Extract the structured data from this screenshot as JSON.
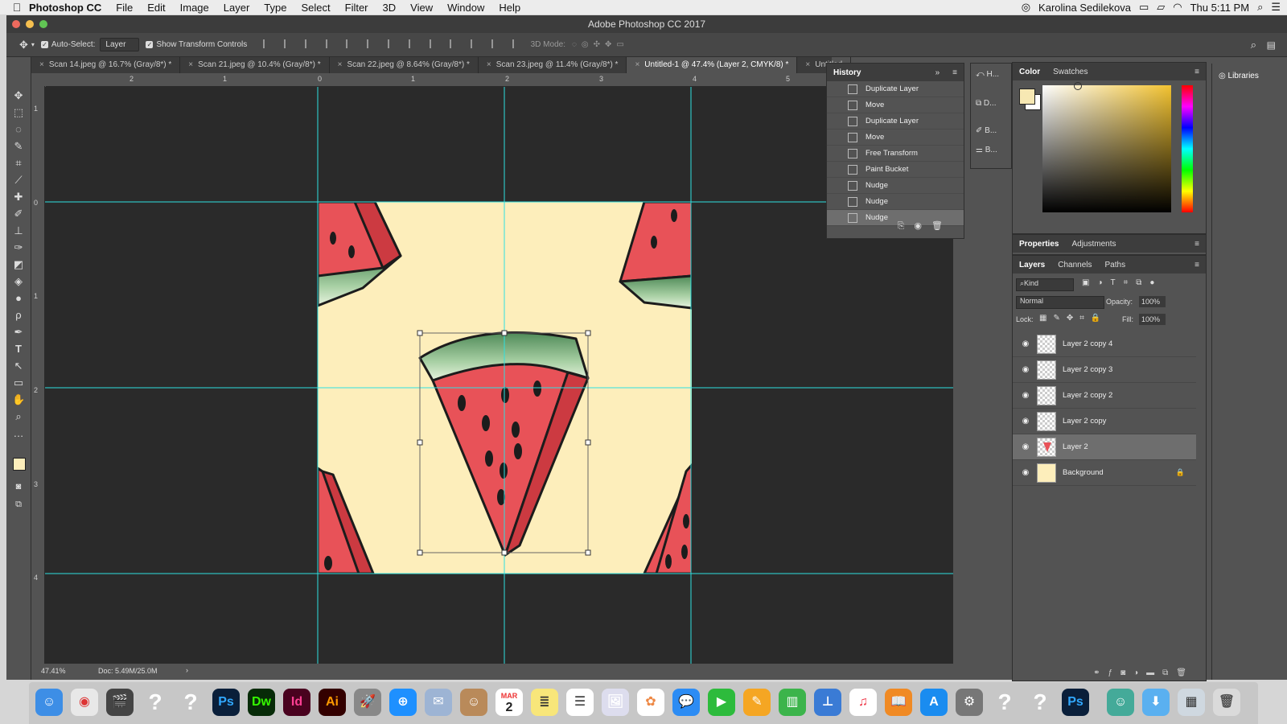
{
  "menubar": {
    "app": "Photoshop CC",
    "items": [
      "File",
      "Edit",
      "Image",
      "Layer",
      "Type",
      "Select",
      "Filter",
      "3D",
      "View",
      "Window",
      "Help"
    ],
    "user": "Karolina Sedilekova",
    "clock": "Thu 5:11 PM"
  },
  "window": {
    "title": "Adobe Photoshop CC 2017"
  },
  "options": {
    "auto_select": "Auto-Select:",
    "layer_select": "Layer",
    "show_transform": "Show Transform Controls",
    "mode_3d": "3D Mode:"
  },
  "tabs": [
    {
      "label": "Scan 14.jpeg @ 16.7% (Gray/8*) *"
    },
    {
      "label": "Scan 21.jpeg @ 10.4% (Gray/8*) *"
    },
    {
      "label": "Scan 22.jpeg @ 8.64% (Gray/8*) *"
    },
    {
      "label": "Scan 23.jpeg @ 11.4% (Gray/8*) *"
    },
    {
      "label": "Untitled-1 @ 47.4% (Layer 2, CMYK/8) *"
    },
    {
      "label": "Untitled"
    }
  ],
  "ruler": {
    "h": [
      "2",
      "1",
      "0",
      "1",
      "2",
      "3",
      "4",
      "5"
    ],
    "v": [
      "1",
      "0",
      "1",
      "2",
      "3",
      "4"
    ]
  },
  "status": {
    "zoom": "47.41%",
    "doc": "Doc: 5.49M/25.0M",
    "arrow": "›"
  },
  "history": {
    "title": "History",
    "items": [
      "Duplicate Layer",
      "Move",
      "Duplicate Layer",
      "Move",
      "Free Transform",
      "Paint Bucket",
      "Nudge",
      "Nudge",
      "Nudge"
    ]
  },
  "side_strip": {
    "items": [
      "H...",
      "D...",
      "B...",
      "B..."
    ]
  },
  "color_panel": {
    "tabs": [
      "Color",
      "Swatches"
    ],
    "fg": "#f7e8b3"
  },
  "libraries": {
    "label": "Libraries"
  },
  "properties": {
    "tabs": [
      "Properties",
      "Adjustments"
    ]
  },
  "layers_panel": {
    "tabs": [
      "Layers",
      "Channels",
      "Paths"
    ],
    "kind": "Kind",
    "blend": "Normal",
    "opacity_label": "Opacity:",
    "opacity": "100%",
    "lock_label": "Lock:",
    "fill_label": "Fill:",
    "fill": "100%",
    "layers": [
      {
        "name": "Layer 2 copy 4"
      },
      {
        "name": "Layer 2 copy 3"
      },
      {
        "name": "Layer 2 copy 2"
      },
      {
        "name": "Layer 2 copy"
      },
      {
        "name": "Layer 2"
      },
      {
        "name": "Background"
      }
    ]
  },
  "colors": {
    "doc_bg": "#fdeebb",
    "melon_red": "#e85258",
    "melon_dark": "#cc3a41",
    "rind_green": "#6c9e6d",
    "guide": "#2ee0e0"
  },
  "dock": {
    "apps": [
      "Finder",
      "Chrome",
      "Final Cut",
      "?",
      "?",
      "Ps",
      "Dw",
      "Id",
      "Ai",
      "Launchpad",
      "Safari",
      "Mail",
      "Contacts",
      "Calendar",
      "Notes",
      "Reminders",
      "Preview",
      "Photos",
      "Messages",
      "FaceTime",
      "Pages",
      "Numbers",
      "Keynote",
      "iTunes",
      "iBooks",
      "App Store",
      "System Preferences",
      "?",
      "?",
      "Ps",
      "Photo Booth",
      "Downloads",
      "Trash"
    ],
    "calendar_month": "MAR",
    "calendar_day": "2"
  }
}
